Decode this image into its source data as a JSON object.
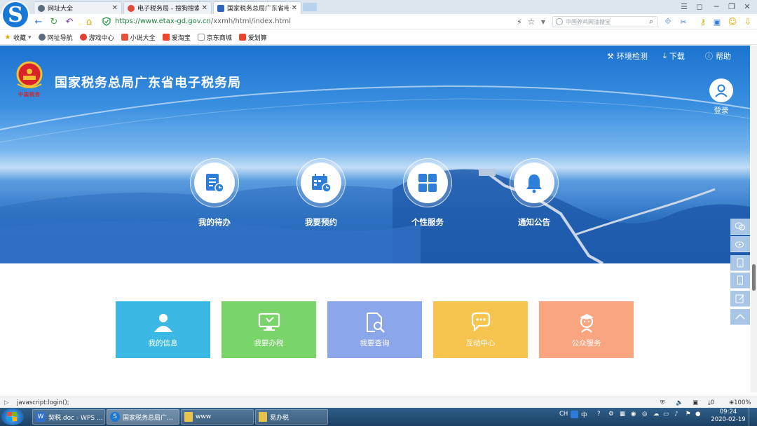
{
  "browser": {
    "tabs": [
      {
        "label": "网址大全",
        "close": "✕"
      },
      {
        "label": "电子税务局 - 搜狗搜索",
        "close": "✕"
      },
      {
        "label": "国家税务总局广东省电子",
        "close": "✕"
      }
    ],
    "url_host": "https://www.etax-gd.gov.cn",
    "url_path": "/xxmh/html/index.html",
    "search_placeholder": "中国养鸡网油搜宝",
    "bookmarks": [
      "收藏",
      "网址导航",
      "游戏中心",
      "小说大全",
      "爱淘宝",
      "京东商城",
      "爱划算"
    ],
    "status_text": "javascript:login();",
    "zoom": "100%",
    "download_count": "0"
  },
  "site": {
    "title": "国家税务总局广东省电子税务局",
    "seal_text": "中国税务",
    "links": {
      "env_check": "环境检测",
      "download": "下载",
      "help": "帮助"
    },
    "login_label": "登录",
    "services": [
      {
        "label": "我的待办",
        "icon": "document-clock-icon"
      },
      {
        "label": "我要预约",
        "icon": "calendar-clock-icon"
      },
      {
        "label": "个性服务",
        "icon": "grid-icon"
      },
      {
        "label": "通知公告",
        "icon": "bell-icon"
      }
    ],
    "tiles": [
      {
        "label": "我的信息",
        "color": "#3bb8e4",
        "icon": "user-icon"
      },
      {
        "label": "我要办税",
        "color": "#79d46a",
        "icon": "monitor-icon"
      },
      {
        "label": "我要查询",
        "color": "#8ca6ea",
        "icon": "search-document-icon"
      },
      {
        "label": "互动中心",
        "color": "#f6c44f",
        "icon": "chat-icon"
      },
      {
        "label": "公众服务",
        "color": "#f9a680",
        "icon": "service-person-icon"
      }
    ]
  },
  "taskbar": {
    "items": [
      {
        "label": "契税.doc - WPS ..."
      },
      {
        "label": "国家税务总局广..."
      },
      {
        "label": "www"
      },
      {
        "label": "易办税"
      }
    ],
    "lang": "CH",
    "ime": "中",
    "time": "09:24",
    "date": "2020-02-19"
  }
}
